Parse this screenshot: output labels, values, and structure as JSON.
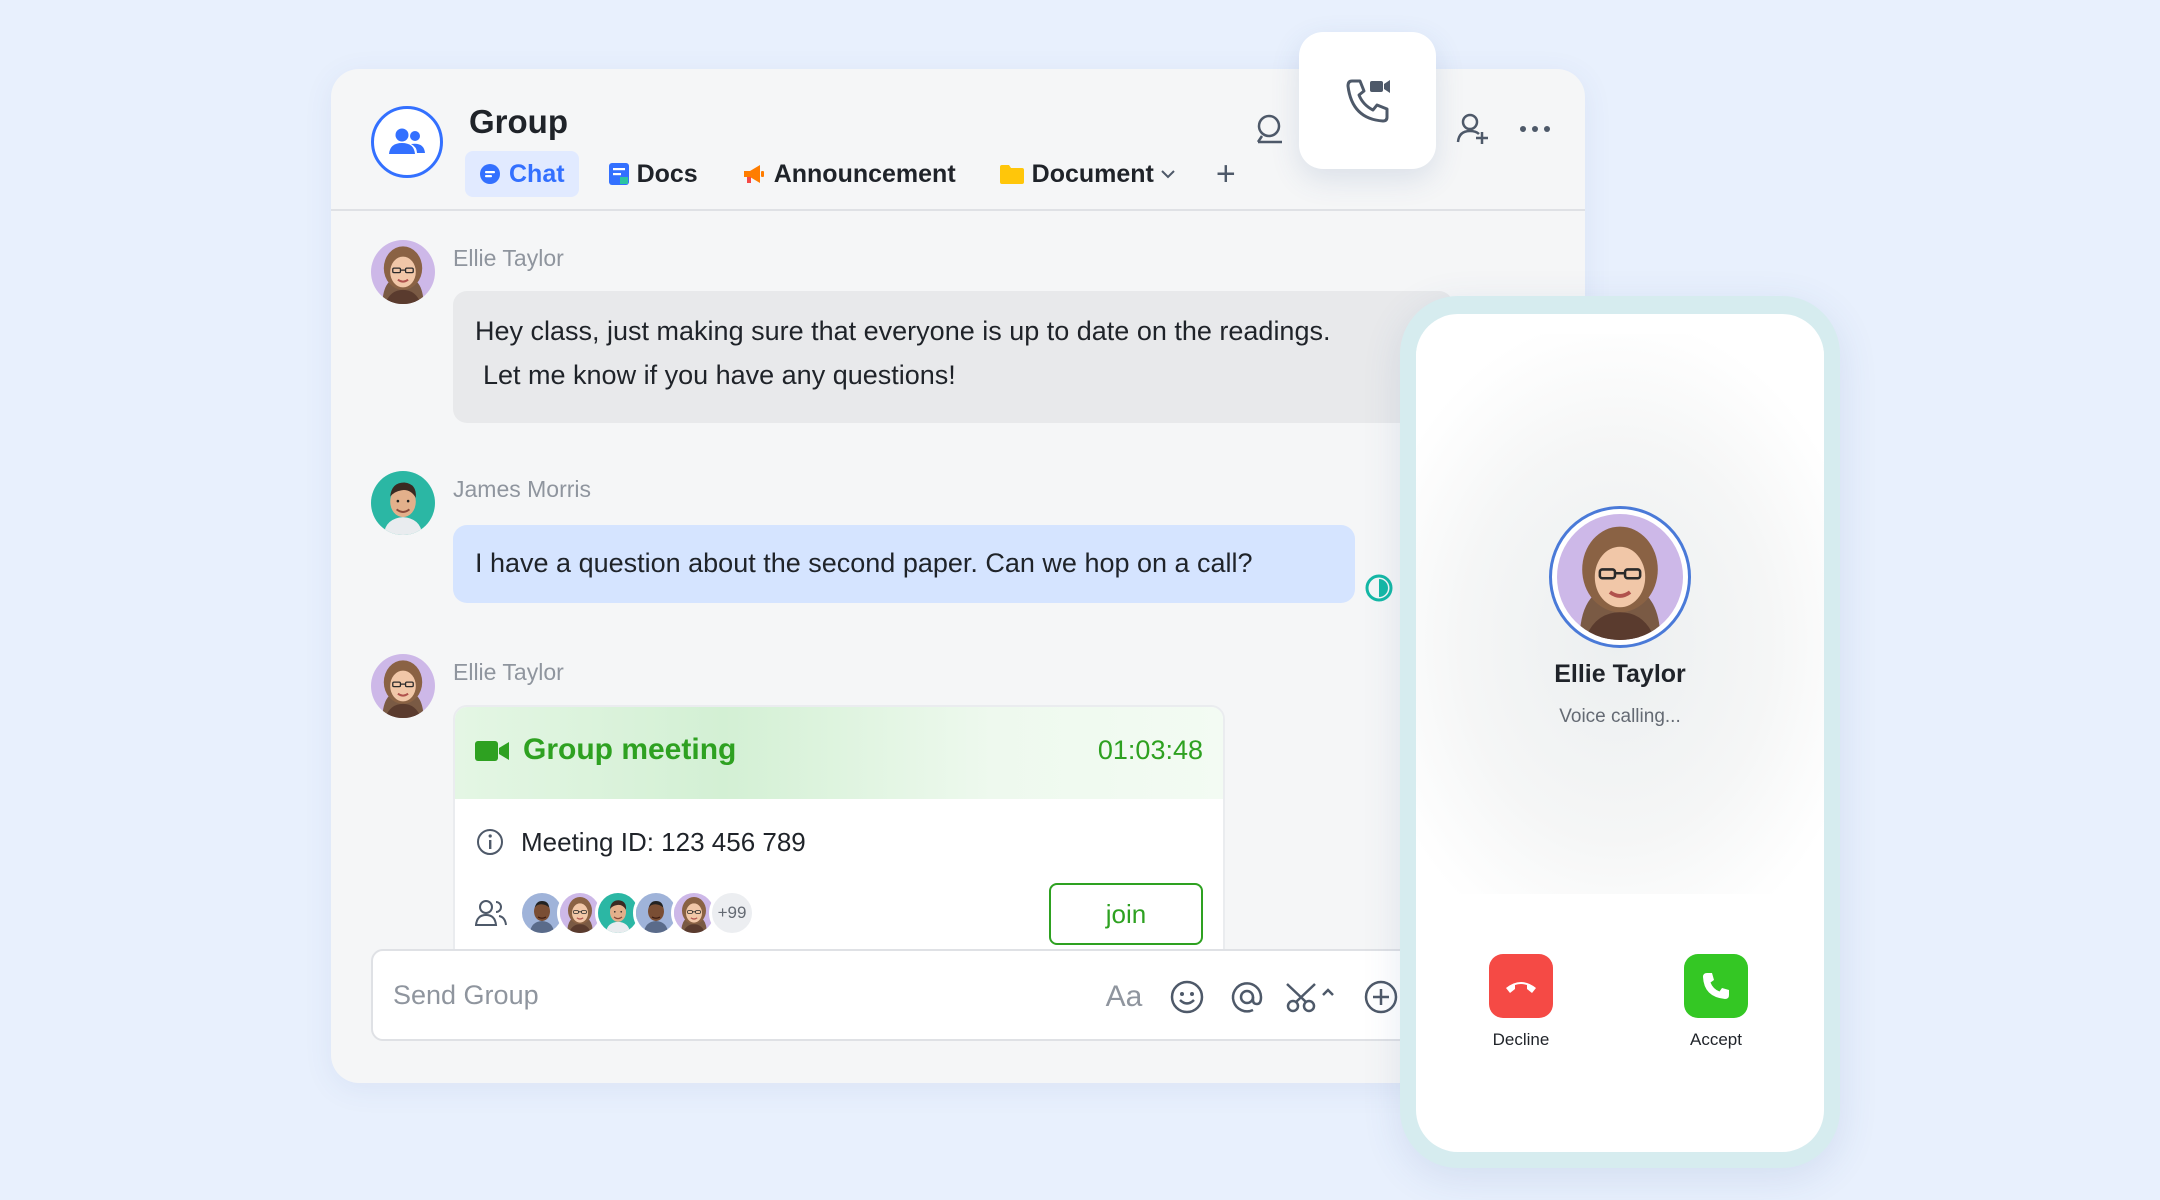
{
  "colors": {
    "accent": "#3370ff",
    "green": "#2ea121",
    "decline": "#f54a45",
    "accept": "#34c724",
    "background": "#e8f0fd"
  },
  "header": {
    "title": "Group",
    "tabs": [
      {
        "label": "Chat",
        "icon": "chat-bubble-icon",
        "active": true
      },
      {
        "label": "Docs",
        "icon": "docs-icon",
        "active": false
      },
      {
        "label": "Announcement",
        "icon": "megaphone-icon",
        "active": false
      },
      {
        "label": "Document",
        "icon": "folder-icon",
        "active": false
      }
    ],
    "add_tab": "+",
    "icons": [
      "search-icon",
      "add-member-icon",
      "more-icon"
    ]
  },
  "float_button": {
    "icon": "video-phone-call-icon"
  },
  "messages": [
    {
      "sender": "Ellie Taylor",
      "text_line1": "Hey class, just making sure that everyone is up to date on the readings.",
      "text_line2": "Let me know if you have any questions!"
    },
    {
      "sender": "James Morris",
      "text": "I have a question about the second paper. Can we hop on a call?"
    },
    {
      "sender": "Ellie Taylor"
    }
  ],
  "meeting": {
    "title": "Group meeting",
    "duration": "01:03:48",
    "meeting_id": "Meeting ID: 123 456 789",
    "more_count": "+99",
    "join_label": "join"
  },
  "composer": {
    "placeholder": "Send Group",
    "font_icon_label": "Aa"
  },
  "call": {
    "caller": "Ellie Taylor",
    "status": "Voice calling...",
    "decline_label": "Decline",
    "accept_label": "Accept"
  }
}
